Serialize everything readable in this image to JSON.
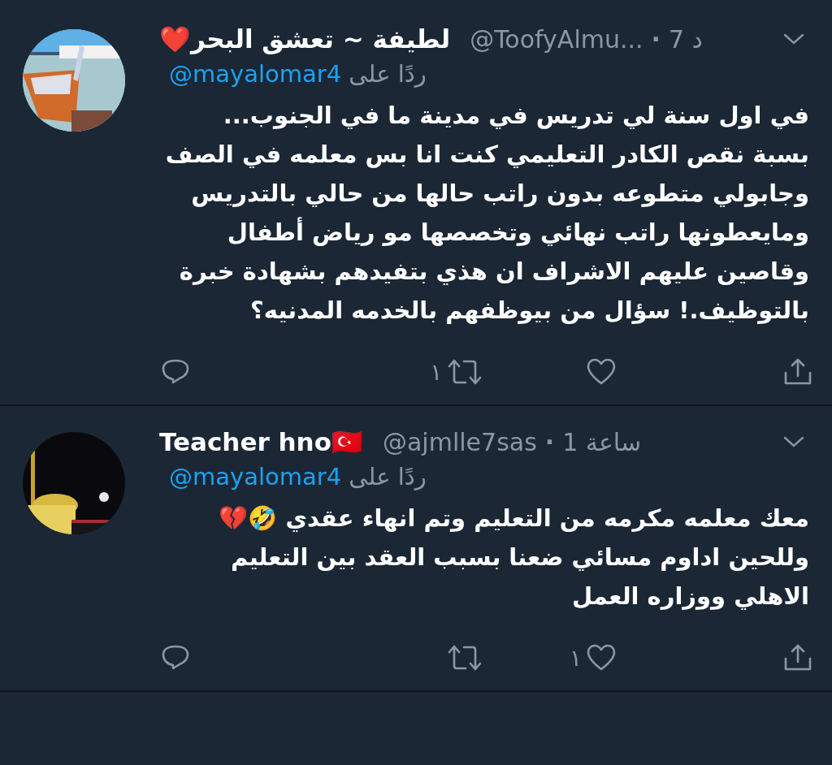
{
  "tweets": [
    {
      "name": "لطيفة ~ تعشق البحر❤️",
      "handle": "@ToofyAlmu...",
      "separator": "·",
      "time": "7 د",
      "reply_prefix": "ردًا على",
      "reply_to": "@mayalomar4",
      "text": "في اول سنة لي تدريس في مدينة ما في الجنوب... بسبة نقص الكادر التعليمي كنت انا بس معلمه في الصف وجابولي متطوعه بدون راتب حالها من حالي بالتدريس ومايعطونها راتب نهائي وتخصصها مو رياض أطفال وقاصين عليهم الاشراف ان هذي بتفيدهم بشهادة خبرة بالتوظيف.! سؤال من بيوظفهم بالخدمه المدنيه؟",
      "actions": [
        {
          "kind": "reply"
        },
        {
          "kind": "retweet",
          "count": "١"
        },
        {
          "kind": "like"
        },
        {
          "kind": "share"
        }
      ]
    },
    {
      "name": "Teacher hno🇹🇷",
      "handle": "@ajmlle7sas",
      "separator": "·",
      "time": "1 ساعة",
      "reply_prefix": "ردًا على",
      "reply_to": "@mayalomar4",
      "text": "معك معلمه مكرمه من التعليم وتم انهاء عقدي 🤣💔 وللحين اداوم مسائي ضعنا بسبب العقد  بين التعليم الاهلي ووزاره العمل",
      "actions": [
        {
          "kind": "reply"
        },
        {
          "kind": "retweet"
        },
        {
          "kind": "like",
          "count": "١"
        },
        {
          "kind": "share"
        }
      ]
    }
  ]
}
